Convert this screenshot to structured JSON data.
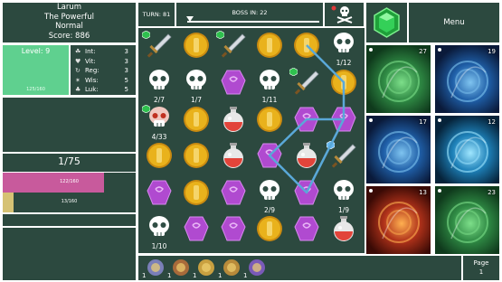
{
  "player": {
    "name": "Larum",
    "title": "The Powerful",
    "difficulty": "Normal",
    "score_label": "Score: 886"
  },
  "level": {
    "label": "Level: 9",
    "xp_text": "125/160",
    "xp_fraction": 0.78
  },
  "stats": [
    {
      "icon": "brain-icon",
      "name": "Int:",
      "value": "3"
    },
    {
      "icon": "heart-icon",
      "name": "Vit:",
      "value": "3"
    },
    {
      "icon": "regen-icon",
      "name": "Reg:",
      "value": "3"
    },
    {
      "icon": "wisdom-icon",
      "name": "Wis:",
      "value": "5"
    },
    {
      "icon": "clover-icon",
      "name": "Luk:",
      "value": "5"
    }
  ],
  "turn_counter": "1/75",
  "hp": {
    "text": "122/160",
    "fraction": 0.7625,
    "color": "#c85a9c"
  },
  "mp": {
    "text": "13/160",
    "fraction": 0.08,
    "color": "#d6c274"
  },
  "top": {
    "turn_label": "TURN: 81",
    "boss_label": "BOSS IN: 22",
    "boss_progress": 0.0
  },
  "menu_label": "Menu",
  "colors": {
    "panel": "#2c493f",
    "board": "#2f4d44",
    "gold": "#e9b21c",
    "potion": "#e2443a",
    "gem_purple": "#b04ad0",
    "path": "#5aa8d8",
    "emerald": "#2fc04e"
  },
  "board": {
    "rows": [
      [
        {
          "type": "sword",
          "badge": "green-gem"
        },
        {
          "type": "coin"
        },
        {
          "type": "sword",
          "badge": "green-gem"
        },
        {
          "type": "coin"
        },
        {
          "type": "coin"
        },
        {
          "type": "skull",
          "label": "1/12"
        }
      ],
      [
        {
          "type": "skull",
          "label": "2/7"
        },
        {
          "type": "skull",
          "label": "1/7"
        },
        {
          "type": "purple-gem"
        },
        {
          "type": "skull",
          "label": "1/11"
        },
        {
          "type": "sword",
          "badge": "green-gem"
        },
        {
          "type": "coin"
        }
      ],
      [
        {
          "type": "skull-red",
          "label": "4/33",
          "badge": "green-gem"
        },
        {
          "type": "coin"
        },
        {
          "type": "potion"
        },
        {
          "type": "coin"
        },
        {
          "type": "purple-gem"
        },
        {
          "type": "purple-gem"
        }
      ],
      [
        {
          "type": "coin"
        },
        {
          "type": "coin"
        },
        {
          "type": "potion"
        },
        {
          "type": "purple-gem"
        },
        {
          "type": "potion"
        },
        {
          "type": "sword",
          "badge": "blue-gem"
        }
      ],
      [
        {
          "type": "purple-gem"
        },
        {
          "type": "coin"
        },
        {
          "type": "purple-gem"
        },
        {
          "type": "skull",
          "label": "2/9"
        },
        {
          "type": "purple-gem"
        },
        {
          "type": "skull",
          "label": "1/9"
        }
      ],
      [
        {
          "type": "skull",
          "label": "1/10"
        },
        {
          "type": "purple-gem"
        },
        {
          "type": "purple-gem"
        },
        {
          "type": "coin"
        },
        {
          "type": "purple-gem"
        },
        {
          "type": "potion"
        }
      ]
    ],
    "selection_path": [
      [
        5,
        2
      ],
      [
        4,
        4
      ],
      [
        3,
        3
      ],
      [
        4,
        2
      ],
      [
        5,
        2
      ],
      [
        5,
        1
      ],
      [
        4,
        0
      ]
    ]
  },
  "skills": [
    {
      "name": "scroll-skill",
      "cooldown": "27",
      "theme": "green"
    },
    {
      "name": "mind-skill",
      "cooldown": "19",
      "theme": "blue"
    },
    {
      "name": "whirl-skill",
      "cooldown": "17",
      "theme": "blue"
    },
    {
      "name": "vortex-skill",
      "cooldown": "12",
      "theme": "cyan"
    },
    {
      "name": "fire-skill",
      "cooldown": "13",
      "theme": "red"
    },
    {
      "name": "leaf-skill",
      "cooldown": "23",
      "theme": "green"
    }
  ],
  "inventory": [
    {
      "name": "sword-item",
      "count": "1"
    },
    {
      "name": "potion-set-item",
      "count": "1"
    },
    {
      "name": "amulet-item",
      "count": "1"
    },
    {
      "name": "treasure-item",
      "count": "1"
    },
    {
      "name": "crystal-item",
      "count": "1"
    }
  ],
  "page": {
    "label": "Page",
    "number": "1"
  }
}
